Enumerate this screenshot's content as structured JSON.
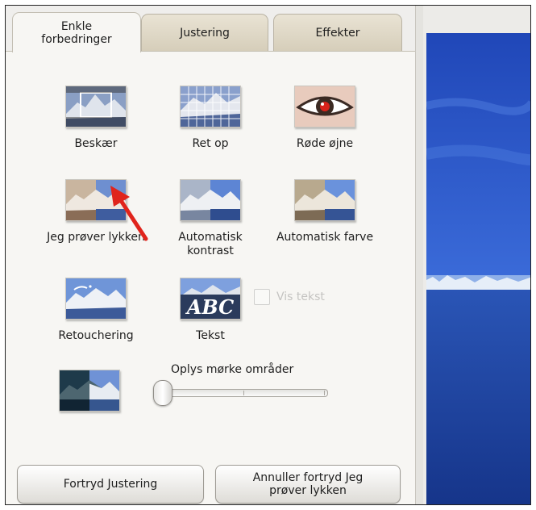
{
  "tabs": [
    {
      "label": "Enkle forbedringer",
      "active": true
    },
    {
      "label": "Justering",
      "active": false
    },
    {
      "label": "Effekter",
      "active": false
    }
  ],
  "tools": [
    {
      "label": "Beskær",
      "icon": "crop-icon"
    },
    {
      "label": "Ret op",
      "icon": "straighten-icon"
    },
    {
      "label": "Røde øjne",
      "icon": "red-eye-icon"
    },
    {
      "label": "Jeg prøver lykken",
      "icon": "im-feeling-lucky-icon"
    },
    {
      "label": "Automatisk kontrast",
      "icon": "auto-contrast-icon"
    },
    {
      "label": "Automatisk farve",
      "icon": "auto-color-icon"
    },
    {
      "label": "Retouchering",
      "icon": "retouch-icon"
    },
    {
      "label": "Tekst",
      "icon": "text-icon",
      "icon_text": "ABC"
    }
  ],
  "show_text_checkbox": {
    "label": "Vis tekst",
    "checked": false,
    "enabled": false
  },
  "fill_light": {
    "label": "Oplys mørke områder",
    "value": 0
  },
  "buttons": {
    "undo": "Fortryd Justering",
    "cancel_undo": "Annuller fortryd Jeg prøver lykken"
  },
  "colors": {
    "sky": "#2a57c8",
    "sea": "#1a3f9c",
    "arrow": "#e0241c"
  }
}
